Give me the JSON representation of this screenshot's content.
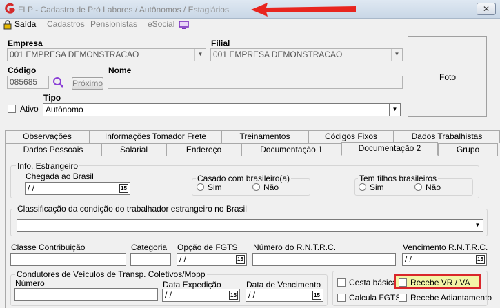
{
  "window": {
    "title": "FLP - Cadastro de Pró Labores / Autônomos / Estagiários",
    "close": "✕"
  },
  "menu": {
    "saida": "Saída",
    "cadastros": "Cadastros",
    "pensionistas": "Pensionistas",
    "esocial": "eSocial"
  },
  "form": {
    "empresa_label": "Empresa",
    "empresa_value": "001 EMPRESA DEMONSTRACAO",
    "filial_label": "Filial",
    "filial_value": "001 EMPRESA DEMONSTRACAO",
    "codigo_label": "Código",
    "codigo_value": "085685",
    "proximo_label": "Próximo",
    "nome_label": "Nome",
    "nome_value": "",
    "foto_label": "Foto",
    "ativo_label": "Ativo",
    "tipo_label": "Tipo",
    "tipo_value": "Autônomo"
  },
  "tabs_row1": [
    "Observações",
    "Informações Tomador Frete",
    "Treinamentos",
    "Códigos Fixos",
    "Dados Trabalhistas"
  ],
  "tabs_row2": [
    "Dados Pessoais",
    "Salarial",
    "Endereço",
    "Documentação 1",
    "Documentação 2",
    "Grupo"
  ],
  "active_tab": "Documentação 2",
  "estrangeiro": {
    "group_label": "Info. Estrangeiro",
    "chegada_label": "Chegada ao Brasil",
    "chegada_value": " / /",
    "casado_label": "Casado com brasileiro(a)",
    "filhos_label": "Tem filhos brasileiros",
    "sim": "Sim",
    "nao": "Não"
  },
  "classificacao": {
    "group_label": "Classificação da condição do trabalhador estrangeiro no Brasil",
    "value": ""
  },
  "row3": {
    "classe_label": "Classe Contribuição",
    "categoria_label": "Categoria",
    "opcao_fgts_label": "Opção de FGTS",
    "opcao_fgts_value": " / /",
    "rntrc_label": "Número do R.N.T.R.C.",
    "venc_rntrc_label": "Vencimento R.N.T.R.C.",
    "venc_rntrc_value": " / /"
  },
  "condutores": {
    "group_label": "Condutores de Veículos de Transp. Coletivos/Mopp",
    "numero_label": "Número",
    "expedicao_label": "Data Expedição",
    "expedicao_value": " / /",
    "vencimento_label": "Data de Vencimento",
    "vencimento_value": " / /"
  },
  "checks": {
    "cesta_label": "Cesta básica",
    "vrva_label": "Recebe VR / VA",
    "fgts_label": "Calcula FGTS",
    "adiant_label": "Recebe Adiantamento"
  },
  "colors": {
    "annotation_arrow": "#e8251f",
    "highlight_box": "#d9262b",
    "highlight_fill": "#f3f5a8",
    "esocial_icon": "#7b2fbf"
  }
}
